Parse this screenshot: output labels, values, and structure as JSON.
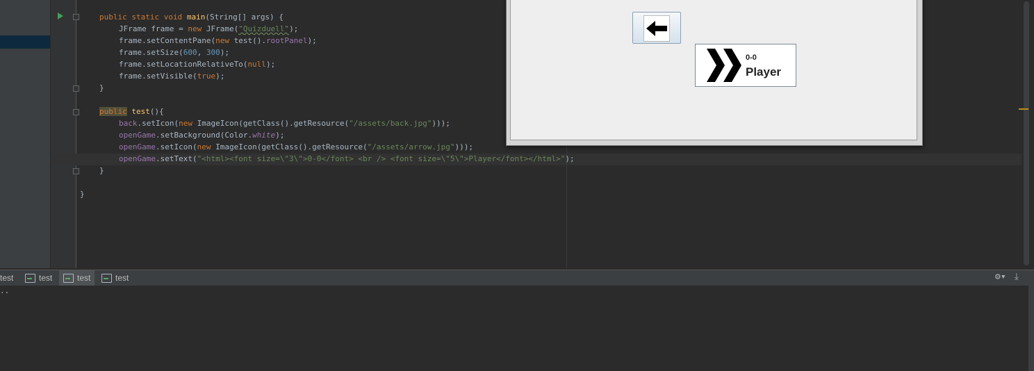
{
  "editor": {
    "lines": {
      "l1": "public static void main(String[] args) {",
      "l2a": "JFrame frame = ",
      "l2b": "new",
      "l2c": " JFrame(",
      "l2d": "\"Quizduell\"",
      "l2e": ");",
      "l3": "frame.setContentPane(new test().rootPanel);",
      "l4": "frame.setSize(600, 300);",
      "l5": "frame.setLocationRelativeTo(null);",
      "l6": "frame.setVisible(true);",
      "l7": "}",
      "l8": "public test(){",
      "l9": "back.setIcon(new ImageIcon(getClass().getResource(\"/assets/back.jpg\")));",
      "l10": "openGame.setBackground(Color.white);",
      "l11": "openGame.setIcon(new ImageIcon(getClass().getResource(\"/assets/arrow.jpg\")));",
      "l12": "openGame.setText(\"<html><font size=\\\"3\\\">0-0</font> <br /> <font size=\\\"5\\\">Player</font></html>\");",
      "l13": "}",
      "l14": "}"
    }
  },
  "swing_window": {
    "open_game_button": {
      "score": "0-0",
      "player": "Player"
    }
  },
  "bottom_panel": {
    "tabs": [
      {
        "label": "test"
      },
      {
        "label": "test"
      },
      {
        "label": "test"
      },
      {
        "label": "test"
      }
    ],
    "console_text": ".."
  },
  "colors": {
    "keyword": "#cc7832",
    "string": "#6a8759",
    "number": "#6897bb",
    "field": "#9876aa",
    "method": "#ffc66d",
    "text": "#a9b7c6"
  }
}
